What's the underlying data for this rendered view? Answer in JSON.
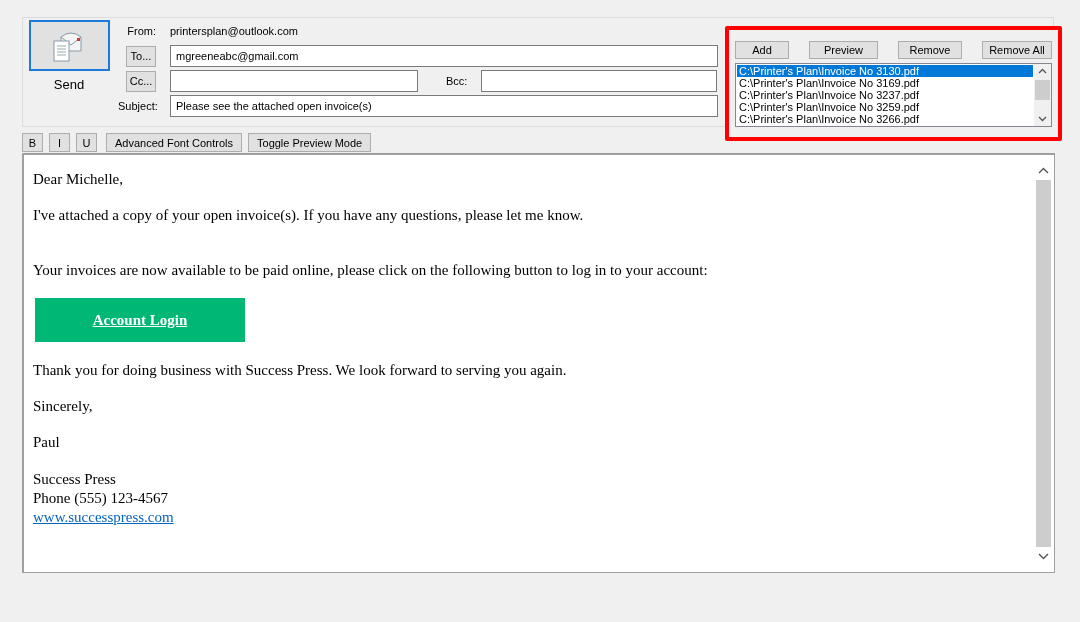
{
  "header": {
    "send_label": "Send",
    "from_label": "From:",
    "from_value": "printersplan@outlook.com",
    "to_button": "To...",
    "to_value": "mgreeneabc@gmail.com",
    "cc_button": "Cc...",
    "bcc_label": "Bcc:",
    "subject_label": "Subject:",
    "subject_value": "Please see the attached open invoice(s)"
  },
  "attachments": {
    "buttons": [
      "Add",
      "Preview",
      "Remove",
      "Remove All"
    ],
    "files": [
      {
        "name": "C:\\Printer's Plan\\Invoice No 3130.pdf",
        "selected": true
      },
      {
        "name": "C:\\Printer's Plan\\Invoice No 3169.pdf",
        "selected": false
      },
      {
        "name": "C:\\Printer's Plan\\Invoice No 3237.pdf",
        "selected": false
      },
      {
        "name": "C:\\Printer's Plan\\Invoice No 3259.pdf",
        "selected": false
      },
      {
        "name": "C:\\Printer's Plan\\Invoice No 3266.pdf",
        "selected": false
      }
    ]
  },
  "toolbar": [
    "B",
    "I",
    "U",
    "Advanced Font Controls",
    "Toggle Preview Mode"
  ],
  "body": [
    {
      "kind": "paragraph",
      "text": "Dear Michelle,"
    },
    {
      "kind": "paragraph",
      "text": "I've attached a copy of your open invoice(s). If you have any questions, please let me know."
    },
    {
      "kind": "spacer"
    },
    {
      "kind": "paragraph",
      "text": "Your invoices are now available to be paid online, please click on the following button to log in to your account:"
    },
    {
      "kind": "button",
      "text": "Account Login"
    },
    {
      "kind": "paragraph",
      "text": "Thank you for doing business with Success Press. We look forward to serving you again."
    },
    {
      "kind": "paragraph",
      "text": "Sincerely,"
    },
    {
      "kind": "paragraph",
      "text": "Paul"
    },
    {
      "kind": "line",
      "text": "Success Press"
    },
    {
      "kind": "line",
      "text": "Phone (555) 123-4567"
    },
    {
      "kind": "link",
      "text": "www.successpress.com"
    }
  ]
}
